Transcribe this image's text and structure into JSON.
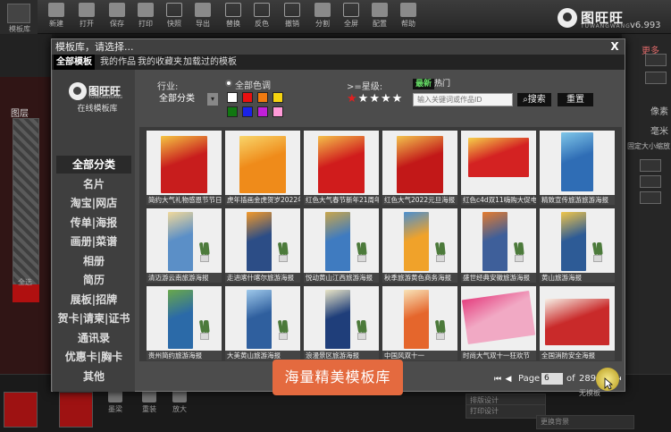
{
  "app": {
    "toolbar": [
      "新建",
      "打开",
      "保存",
      "打印",
      "快照",
      "导出",
      "替换",
      "反色",
      "撤销",
      "分割",
      "全屏",
      "配置",
      "帮助"
    ],
    "brand": {
      "name": "图旺旺",
      "en": "TUWANGWANG",
      "version": "v6.993"
    },
    "left_panel": {
      "title": "图层",
      "footer": "全选"
    },
    "right_panel": {
      "labels": [
        "更多",
        "像素",
        "毫米",
        "固定大小缩放"
      ]
    },
    "bottom_tools": [
      "墨梁",
      "重装",
      "放大"
    ],
    "bottom_right_rows": [
      "排版设计",
      "打印设计",
      "更换背景"
    ]
  },
  "dialog": {
    "title": "模板库，请选择...",
    "close": "X",
    "tabs": [
      "全部模板",
      "我的作品",
      "我的收藏夹",
      "加载过的模板"
    ],
    "sidebar": {
      "logo_name": "图旺旺",
      "logo_en": "TUWANGWANG",
      "subtitle": "在线模板库",
      "categories": [
        "全部分类",
        "名片",
        "淘宝|网店",
        "传单|海报",
        "画册|菜谱",
        "相册",
        "简历",
        "展板|招牌",
        "贺卡|请柬|证书",
        "通讯录",
        "优惠卡|胸卡",
        "其他"
      ]
    },
    "filters": {
      "industry_label": "行业:",
      "industry_value": "全部分类",
      "color_label": "全部色调",
      "swatches": [
        "#ffffff",
        "#e81010",
        "#f07a10",
        "#f5d410",
        "#117711",
        "#1a22e8",
        "#c21fd8",
        "#ff9ad8"
      ],
      "star_label": ">=星级:",
      "stars_on": 1,
      "stars_total": 5,
      "sort_new": "最新",
      "sort_hot": "热门",
      "search_placeholder": "输入关键词或作品ID",
      "search_button": "搜索",
      "reset_button": "重置"
    },
    "templates": [
      {
        "caption": "简约大气礼物感恩节节日",
        "bg": "#c81d1d",
        "accent": "#f5c542"
      },
      {
        "caption": "虎年插画金虎贺岁2022年",
        "bg": "#ef8b1a",
        "accent": "#f8d56a"
      },
      {
        "caption": "红色大气春节新年21周年",
        "bg": "#d01c1c",
        "accent": "#f4c04a"
      },
      {
        "caption": "红色大气2022元旦海报",
        "bg": "#c21818",
        "accent": "#f3c34d"
      },
      {
        "caption": "红色c4d双11嗨购大促电",
        "bg": "#d42222",
        "accent": "#f6d04a"
      },
      {
        "caption": "精致宣传旅游旅游海报",
        "bg": "#2f6db5",
        "accent": "#7fc6e8"
      },
      {
        "caption": "清迈游云南旅游海报",
        "bg": "#5b8fc7",
        "accent": "#f1d99a"
      },
      {
        "caption": "走进喀什喀尔旅游海报",
        "bg": "#2c4d86",
        "accent": "#f39a2a"
      },
      {
        "caption": "悦动黄山江西旅游海报",
        "bg": "#3f7bc0",
        "accent": "#c9a64b"
      },
      {
        "caption": "秋季旅游黄色商务海报",
        "bg": "#f0a22a",
        "accent": "#4a8fd0"
      },
      {
        "caption": "盛世经典安徽旅游海报",
        "bg": "#3e5f9a",
        "accent": "#e47b2e"
      },
      {
        "caption": "黄山旅游海报",
        "bg": "#2d5b96",
        "accent": "#f0c64a"
      },
      {
        "caption": "贵州简约旅游海报",
        "bg": "#2b6aa8",
        "accent": "#69a84a"
      },
      {
        "caption": "大美黄山旅游海报",
        "bg": "#2f5f9e",
        "accent": "#9ec8ea"
      },
      {
        "caption": "浪漫景区旅游海报",
        "bg": "#1f3e7a",
        "accent": "#e9e4c6"
      },
      {
        "caption": "中国风双十一",
        "bg": "#e5662c",
        "accent": "#f8e3b8"
      },
      {
        "caption": "时尚大气双十一狂欢节",
        "bg": "#f1a9c4",
        "accent": "#e54080"
      },
      {
        "caption": "全国消防安全海报",
        "bg": "#c92a2a",
        "accent": "#f7f0e6"
      }
    ],
    "pager": {
      "page_label": "Page",
      "current": 6,
      "of_label": "of",
      "total": 2894
    },
    "no_template_text": "无模板"
  },
  "banner": {
    "text": "海量精美模板库"
  }
}
